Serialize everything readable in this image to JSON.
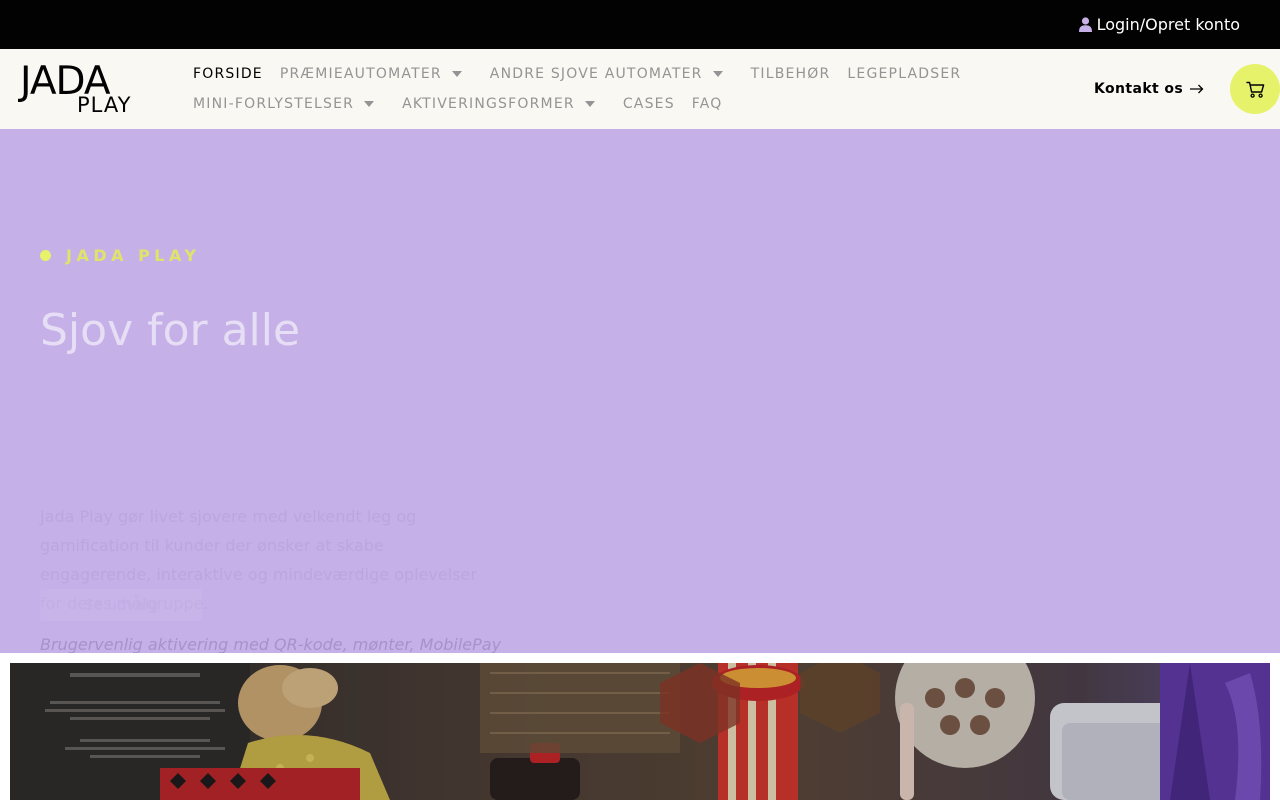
{
  "topbar": {
    "login_label": "Login/Opret konto",
    "icon": "user-icon",
    "icon_color": "#c6b0e8"
  },
  "header": {
    "logo": {
      "line1": "JADA",
      "line2": "PLAY"
    },
    "nav": [
      {
        "label": "Forside",
        "active": true,
        "dropdown": false
      },
      {
        "label": "Præmieautomater",
        "active": false,
        "dropdown": true
      },
      {
        "label": "Andre sjove automater",
        "active": false,
        "dropdown": true
      },
      {
        "label": "Tilbehør",
        "active": false,
        "dropdown": false
      },
      {
        "label": "Legepladser",
        "active": false,
        "dropdown": false
      },
      {
        "label": "Mini-forlystelser",
        "active": false,
        "dropdown": true
      },
      {
        "label": "Aktiveringsformer",
        "active": false,
        "dropdown": true
      },
      {
        "label": "Cases",
        "active": false,
        "dropdown": false
      },
      {
        "label": "FAQ",
        "active": false,
        "dropdown": false
      }
    ],
    "contact_label": "Kontakt os",
    "cart_icon": "cart-icon"
  },
  "hero": {
    "eyebrow": "JADA PLAY",
    "title": "Sjov for alle",
    "text": "Jada Play gør livet sjovere med velkendt leg og gamification til kunder der ønsker at skabe engagerende, interaktive og mindeværdige oplevelser for deres målgruppe.",
    "button_label": "Se udvalg",
    "note": "Brugervenlig aktivering med QR-kode, mønter, MobilePay"
  },
  "colors": {
    "topbar_bg": "#020202",
    "header_bg": "#f9f8f3",
    "hero_bg": "#c6b0e8",
    "accent_yellow": "#e6f26a",
    "nav_inactive": "#949494"
  }
}
